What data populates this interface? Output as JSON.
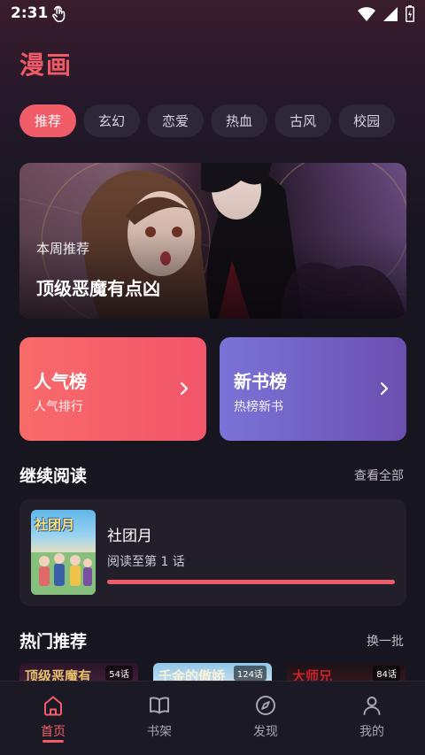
{
  "status_bar": {
    "time": "2:31"
  },
  "app": {
    "title": "漫画"
  },
  "categories": [
    {
      "label": "推荐",
      "active": true
    },
    {
      "label": "玄幻",
      "active": false
    },
    {
      "label": "恋爱",
      "active": false
    },
    {
      "label": "热血",
      "active": false
    },
    {
      "label": "古风",
      "active": false
    },
    {
      "label": "校园",
      "active": false
    }
  ],
  "banner": {
    "subtitle": "本周推荐",
    "title": "顶级恶魔有点凶"
  },
  "rankings": [
    {
      "title": "人气榜",
      "subtitle": "人气排行"
    },
    {
      "title": "新书榜",
      "subtitle": "热榜新书"
    }
  ],
  "continue_reading": {
    "section_title": "继续阅读",
    "link": "查看全部",
    "item": {
      "cover_text": "社团月",
      "title": "社团月",
      "progress_text": "阅读至第 1 话",
      "progress_fraction": 1.0
    }
  },
  "hot": {
    "section_title": "热门推荐",
    "link": "换一批",
    "items": [
      {
        "title": "顶级恶魔有",
        "episodes": "54话"
      },
      {
        "title": "千金的傲娇",
        "episodes": "124话"
      },
      {
        "title": "大师兄",
        "episodes": "84话"
      }
    ]
  },
  "bottom_nav": [
    {
      "label": "首页",
      "icon": "home-icon",
      "active": true
    },
    {
      "label": "书架",
      "icon": "book-icon",
      "active": false
    },
    {
      "label": "发现",
      "icon": "compass-icon",
      "active": false
    },
    {
      "label": "我的",
      "icon": "user-icon",
      "active": false
    }
  ],
  "colors": {
    "accent": "#f05d68",
    "background": "#17151f",
    "card": "#221f2b"
  }
}
